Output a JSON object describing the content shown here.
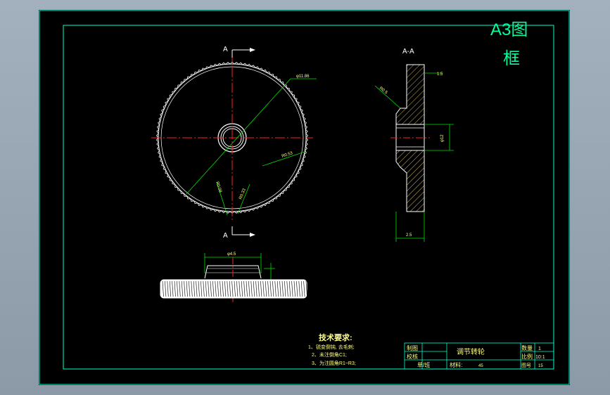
{
  "frame_label_line1": "A3图",
  "frame_label_line2": "框",
  "section_label_top": "A",
  "section_label_bottom": "A",
  "section_view_label": "A-A",
  "dimensions": {
    "outer_dia": "φ11.86",
    "pitch_r": "R0.53",
    "knurl_1": "R0.08",
    "knurl_2": "R0.33",
    "side_r": "R0.5",
    "side_top": "1.5",
    "bore": "φ12",
    "width": "2.5",
    "hub": "φ4.5"
  },
  "tech_requirements": {
    "title": "技术要求:",
    "items": [
      "1、锐变倒钝, 去毛刺;",
      "2、未注倒角C1;",
      "3、为注圆角R1~R3;"
    ]
  },
  "title_block": {
    "drawn_label": "制图",
    "checked_label": "校核",
    "unit_label": "单/班",
    "part_name": "调节转轮",
    "material_label": "材料:",
    "material_value": "45",
    "quantity_label": "数量",
    "quantity_value": "1",
    "scale_label": "比例",
    "scale_value": "10:1",
    "drawing_no_label": "图号",
    "drawing_no_value": "15"
  },
  "colors": {
    "background": "#000000",
    "frame": "#00ffcc",
    "geometry": "#ffffff",
    "center_line": "#ff2020",
    "dimension": "#00e000",
    "hatch": "#ffe07a",
    "text": "#ffff80"
  }
}
